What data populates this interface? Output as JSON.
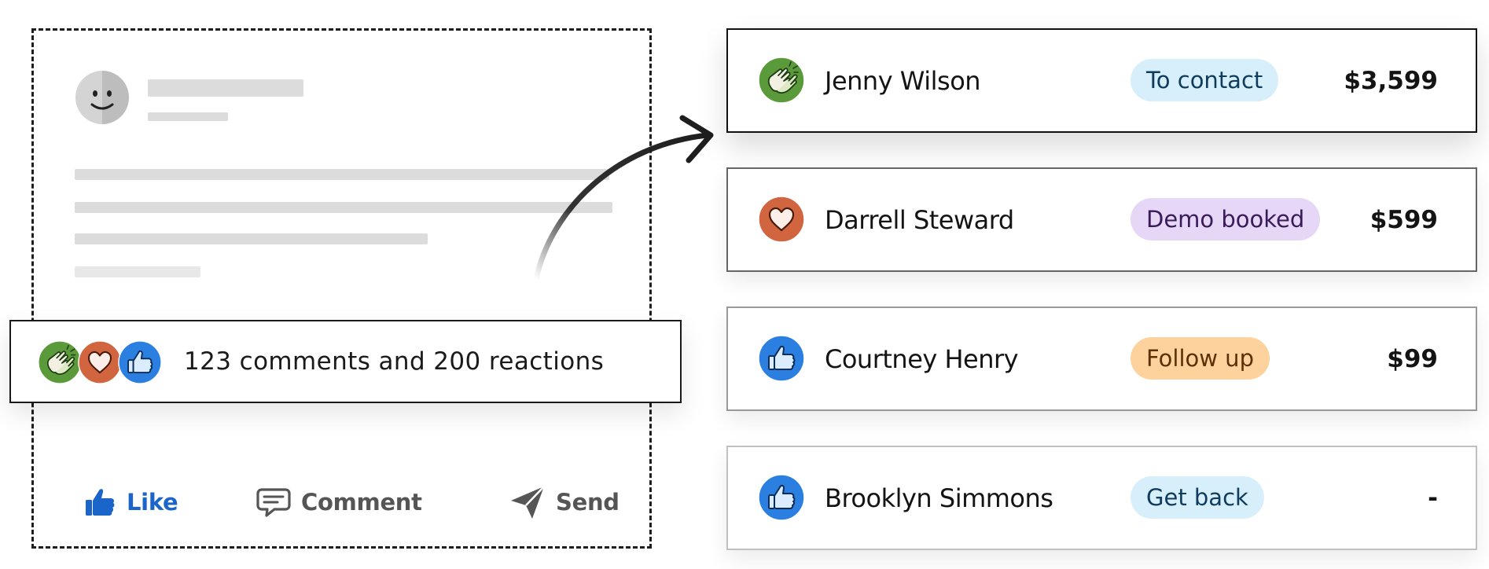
{
  "post": {
    "actions": {
      "like": "Like",
      "comment": "Comment",
      "send": "Send"
    },
    "reactions": {
      "summary": "123 comments and 200 reactions",
      "icons": [
        "clap-reaction-icon",
        "heart-reaction-icon",
        "thumbs-up-reaction-icon"
      ]
    }
  },
  "leads": [
    {
      "name": "Jenny Wilson",
      "reaction": "clap-reaction-icon",
      "status": "To contact",
      "status_bg": "#d7eefb",
      "status_color": "#0f3c5c",
      "amount": "$3,599"
    },
    {
      "name": "Darrell Steward",
      "reaction": "heart-reaction-icon",
      "status": "Demo booked",
      "status_bg": "#e6d7f7",
      "status_color": "#3a1b5a",
      "amount": "$599"
    },
    {
      "name": "Courtney Henry",
      "reaction": "thumbs-up-reaction-icon",
      "status": "Follow up",
      "status_bg": "#fdd29c",
      "status_color": "#5a3206",
      "amount": "$99"
    },
    {
      "name": "Brooklyn Simmons",
      "reaction": "thumbs-up-reaction-icon",
      "status": "Get back",
      "status_bg": "#d7eefb",
      "status_color": "#0f3c5c",
      "amount": "-"
    }
  ],
  "colors": {
    "like_blue": "#1b64c9",
    "clap_green": "#5a9a3a",
    "heart_orange": "#d0653f",
    "thumb_blue": "#2b7fe0"
  }
}
